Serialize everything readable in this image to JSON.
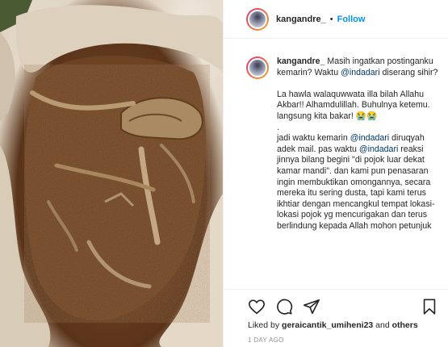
{
  "post": {
    "username": "kangandre_",
    "separator": "•",
    "follow_label": "Follow",
    "caption": {
      "username": "kangandre_",
      "segments": [
        {
          "t": " Masih ingatkan postinganku kemarin? Waktu ",
          "m": false
        },
        {
          "t": "@indadari",
          "m": true
        },
        {
          "t": " diserang sihir?\n\nLa hawla walaquwwata illa bilah Allahu Akbar!! Alhamdulillah. Buhulnya ketemu. langsung kita bakar! 😭😭\n.\njadi waktu kemarin ",
          "m": false
        },
        {
          "t": "@indadari",
          "m": true
        },
        {
          "t": " diruqyah adek mail. pas waktu ",
          "m": false
        },
        {
          "t": "@indadari",
          "m": true
        },
        {
          "t": " reaksi jinnya bilang begini \"di pojok luar dekat kamar mandi\". dan kami pun penasaran ingin membuktikan omongannya, secara mereka itu sering dusta, tapi kami terus ikhtiar dengan mencangkul tempat lokasi-lokasi pojok yg mencurigakan dan terus berlindung kepada Allah mohon petunjuk",
          "m": false
        }
      ]
    },
    "likes": {
      "prefix": "Liked by ",
      "user": "geraicantik_umiheni23",
      "and": " and ",
      "others": "others"
    },
    "time": "1 DAY AGO"
  },
  "icons": {
    "like": "heart-icon",
    "comment": "comment-icon",
    "share": "share-icon",
    "save": "bookmark-icon"
  }
}
